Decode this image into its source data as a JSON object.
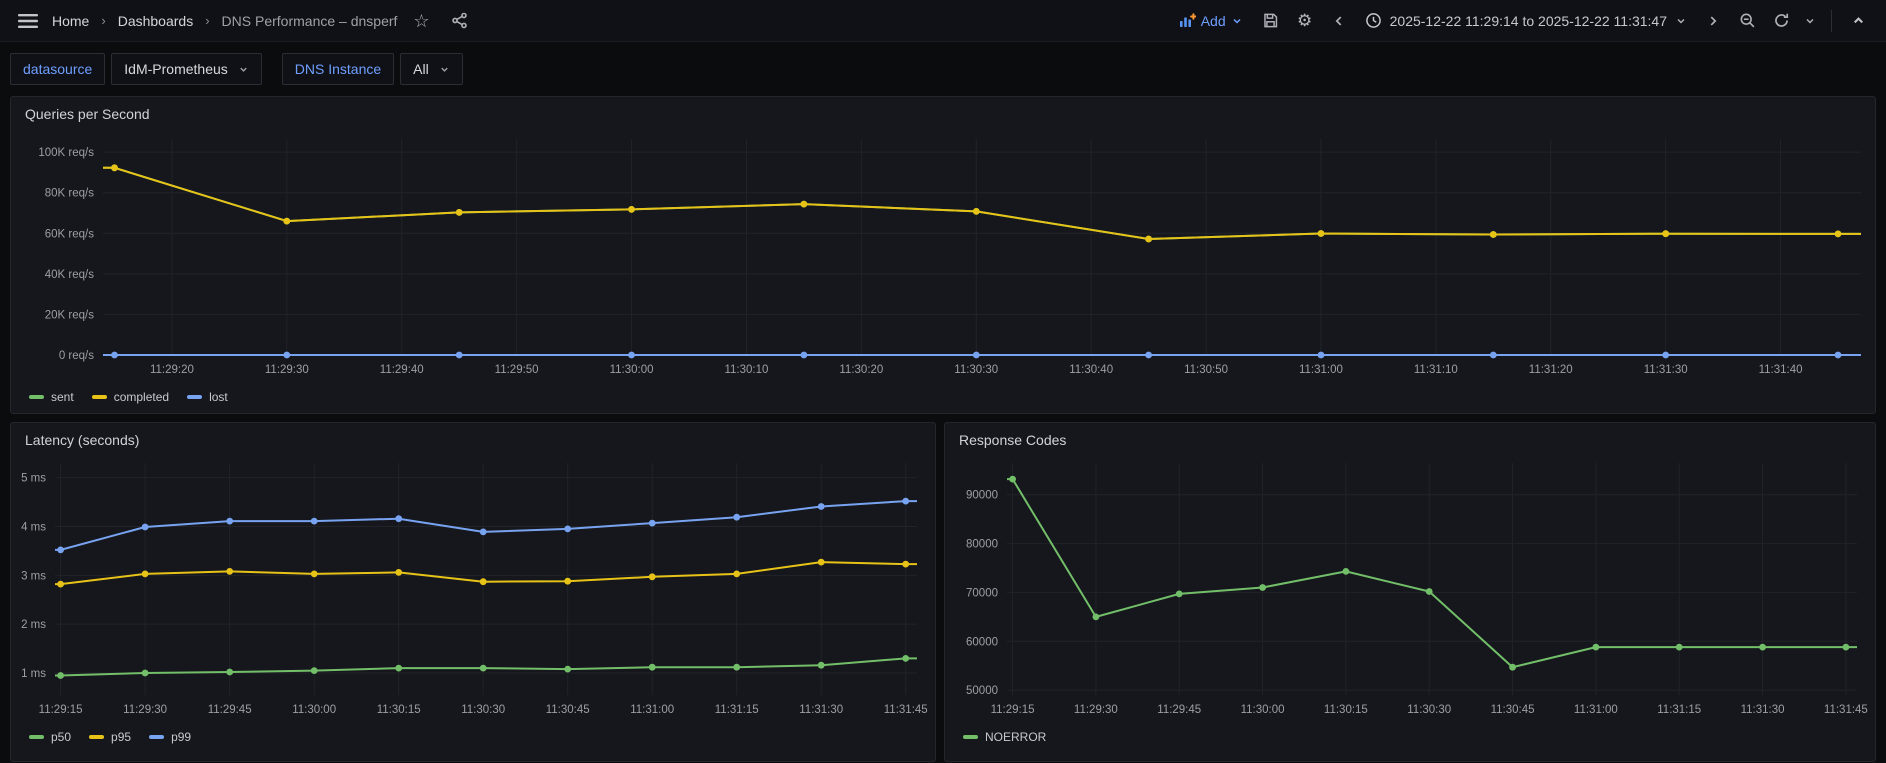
{
  "navbar": {
    "breadcrumb": {
      "home": "Home",
      "separator": "›",
      "section": "Dashboards",
      "page": "DNS Performance – dnsperf"
    },
    "add_label": "Add",
    "time_range": "2025-12-22 11:29:14 to 2025-12-22 11:31:47",
    "icons": [
      "menu-icon",
      "star-icon",
      "share-icon",
      "add-panel-icon",
      "save-icon",
      "settings-icon",
      "time-shift-back-icon",
      "clock-icon",
      "time-shift-forward-icon",
      "zoom-out-icon",
      "refresh-icon",
      "collapse-icon"
    ]
  },
  "variables": [
    {
      "label": "datasource",
      "value": "IdM-Prometheus"
    },
    {
      "label": "DNS Instance",
      "value": "All"
    }
  ],
  "time_domain": {
    "start": "11:29:14",
    "end": "11:31:47"
  },
  "colors": {
    "green": "#73bf69",
    "yellow": "#e7c318",
    "blue": "#78a3f1",
    "accent": "#6e9fff"
  },
  "chart_data": [
    {
      "type": "line",
      "title": "Queries per Second",
      "x": [
        "11:29:15",
        "11:29:30",
        "11:29:45",
        "11:30:00",
        "11:30:15",
        "11:30:30",
        "11:30:45",
        "11:31:00",
        "11:31:15",
        "11:31:30",
        "11:31:45"
      ],
      "series": [
        {
          "name": "sent",
          "color": "#73bf69",
          "values": [
            92300,
            66000,
            70300,
            71800,
            74400,
            70800,
            57200,
            59900,
            59400,
            59800,
            59700
          ]
        },
        {
          "name": "completed",
          "color": "#e7c318",
          "values": [
            92300,
            66000,
            70300,
            71800,
            74400,
            70800,
            57200,
            59900,
            59400,
            59800,
            59700
          ]
        },
        {
          "name": "lost",
          "color": "#78a3f1",
          "values": [
            0,
            0,
            0,
            0,
            0,
            0,
            0,
            0,
            0,
            0,
            0
          ]
        }
      ],
      "ylim": [
        0,
        106500
      ],
      "yticks": [
        {
          "v": 0,
          "label": "0 req/s"
        },
        {
          "v": 20000,
          "label": "20K req/s"
        },
        {
          "v": 40000,
          "label": "40K req/s"
        },
        {
          "v": 60000,
          "label": "60K req/s"
        },
        {
          "v": 80000,
          "label": "80K req/s"
        },
        {
          "v": 100000,
          "label": "100K req/s"
        }
      ],
      "xticks": [
        "11:29:20",
        "11:29:30",
        "11:29:40",
        "11:29:50",
        "11:30:00",
        "11:30:10",
        "11:30:20",
        "11:30:30",
        "11:30:40",
        "11:30:50",
        "11:31:00",
        "11:31:10",
        "11:31:20",
        "11:31:30",
        "11:31:40"
      ],
      "legend_position": "bottom",
      "grid": true
    },
    {
      "type": "line",
      "title": "Latency (seconds)",
      "x": [
        "11:29:15",
        "11:29:30",
        "11:29:45",
        "11:30:00",
        "11:30:15",
        "11:30:30",
        "11:30:45",
        "11:31:00",
        "11:31:15",
        "11:31:30",
        "11:31:45"
      ],
      "series": [
        {
          "name": "p50",
          "color": "#73bf69",
          "values": [
            0.95,
            1.0,
            1.02,
            1.05,
            1.1,
            1.1,
            1.08,
            1.12,
            1.12,
            1.16,
            1.3
          ]
        },
        {
          "name": "p95",
          "color": "#e7c318",
          "values": [
            2.82,
            3.03,
            3.08,
            3.03,
            3.06,
            2.87,
            2.88,
            2.97,
            3.03,
            3.27,
            3.23
          ]
        },
        {
          "name": "p99",
          "color": "#78a3f1",
          "values": [
            3.52,
            3.99,
            4.11,
            4.11,
            4.16,
            3.89,
            3.95,
            4.07,
            4.19,
            4.41,
            4.52
          ]
        }
      ],
      "ylim": [
        0.55,
        5.3
      ],
      "yticks": [
        {
          "v": 1,
          "label": "1 ms"
        },
        {
          "v": 2,
          "label": "2 ms"
        },
        {
          "v": 3,
          "label": "3 ms"
        },
        {
          "v": 4,
          "label": "4 ms"
        },
        {
          "v": 5,
          "label": "5 ms"
        }
      ],
      "xticks": [
        "11:29:15",
        "11:29:30",
        "11:29:45",
        "11:30:00",
        "11:30:15",
        "11:30:30",
        "11:30:45",
        "11:31:00",
        "11:31:15",
        "11:31:30",
        "11:31:45"
      ],
      "legend_position": "bottom",
      "grid": true
    },
    {
      "type": "line",
      "title": "Response Codes",
      "x": [
        "11:29:15",
        "11:29:30",
        "11:29:45",
        "11:30:00",
        "11:30:15",
        "11:30:30",
        "11:30:45",
        "11:31:00",
        "11:31:15",
        "11:31:30",
        "11:31:45"
      ],
      "series": [
        {
          "name": "NOERROR",
          "color": "#73bf69",
          "values": [
            93200,
            65000,
            69700,
            71000,
            74300,
            70200,
            54700,
            58800,
            58800,
            58800,
            58800
          ]
        }
      ],
      "ylim": [
        49000,
        96500
      ],
      "yticks": [
        {
          "v": 50000,
          "label": "50000"
        },
        {
          "v": 60000,
          "label": "60000"
        },
        {
          "v": 70000,
          "label": "70000"
        },
        {
          "v": 80000,
          "label": "80000"
        },
        {
          "v": 90000,
          "label": "90000"
        }
      ],
      "xticks": [
        "11:29:15",
        "11:29:30",
        "11:29:45",
        "11:30:00",
        "11:30:15",
        "11:30:30",
        "11:30:45",
        "11:31:00",
        "11:31:15",
        "11:31:30",
        "11:31:45"
      ],
      "legend_position": "bottom",
      "grid": true
    }
  ]
}
